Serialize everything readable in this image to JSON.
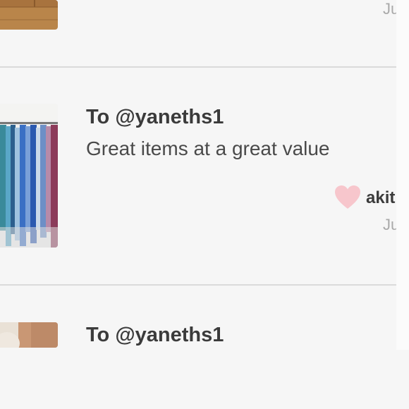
{
  "reviews": [
    {
      "date": "Ju"
    },
    {
      "recipient": "To @yaneths1",
      "message": "Great items at a great value",
      "reviewer": "akit",
      "date": "Ju",
      "heart_color": "#f7c6cc"
    },
    {
      "recipient": "To @yaneths1"
    }
  ]
}
